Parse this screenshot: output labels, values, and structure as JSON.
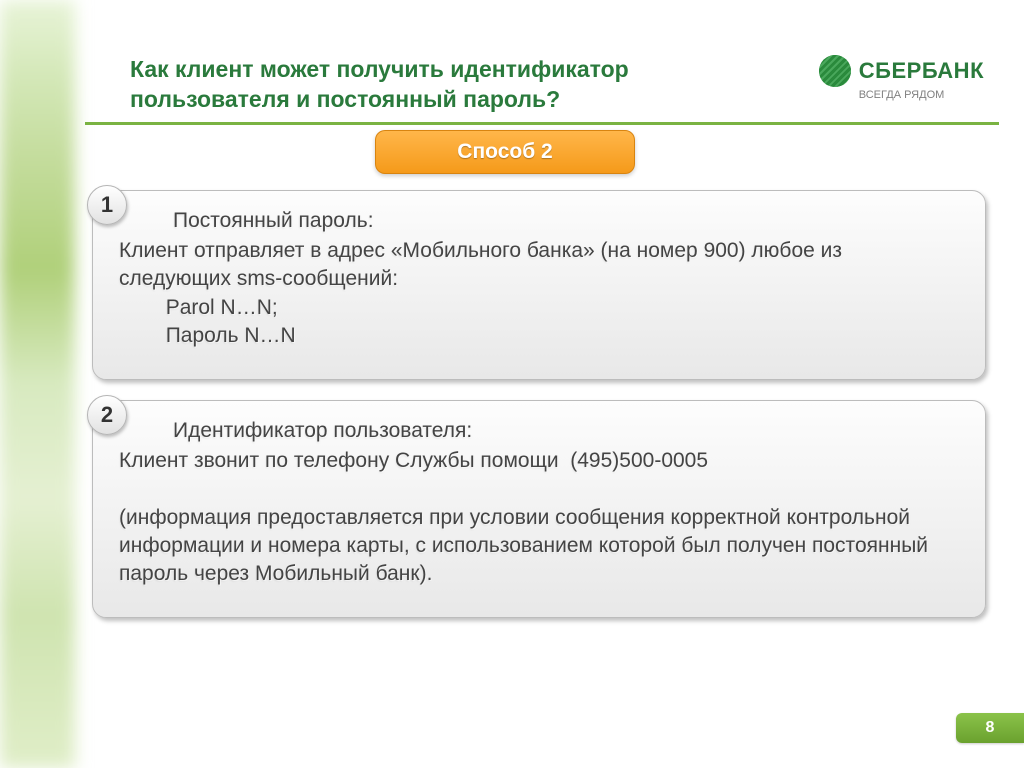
{
  "header": {
    "title": "Как клиент может получить идентификатор пользователя и постоянный пароль?",
    "logo_text": "СБЕРБАНК",
    "logo_tagline": "ВСЕГДА РЯДОМ"
  },
  "tab": {
    "label": "Способ 2"
  },
  "cards": [
    {
      "num": "1",
      "heading": "Постоянный пароль:",
      "body": "Клиент отправляет в адрес «Мобильного банка» (на номер 900) любое из следующих sms-сообщений:\n        Parol N…N;\n        Пароль N…N"
    },
    {
      "num": "2",
      "heading": "Идентификатор пользователя:",
      "body": "Клиент звонит по телефону Службы помощи  (495)500-0005\n\n(информация предоставляется при условии сообщения корректной контрольной информации и номера карты, с использованием которой был получен постоянный пароль через Мобильный банк)."
    }
  ],
  "page_number": "8"
}
